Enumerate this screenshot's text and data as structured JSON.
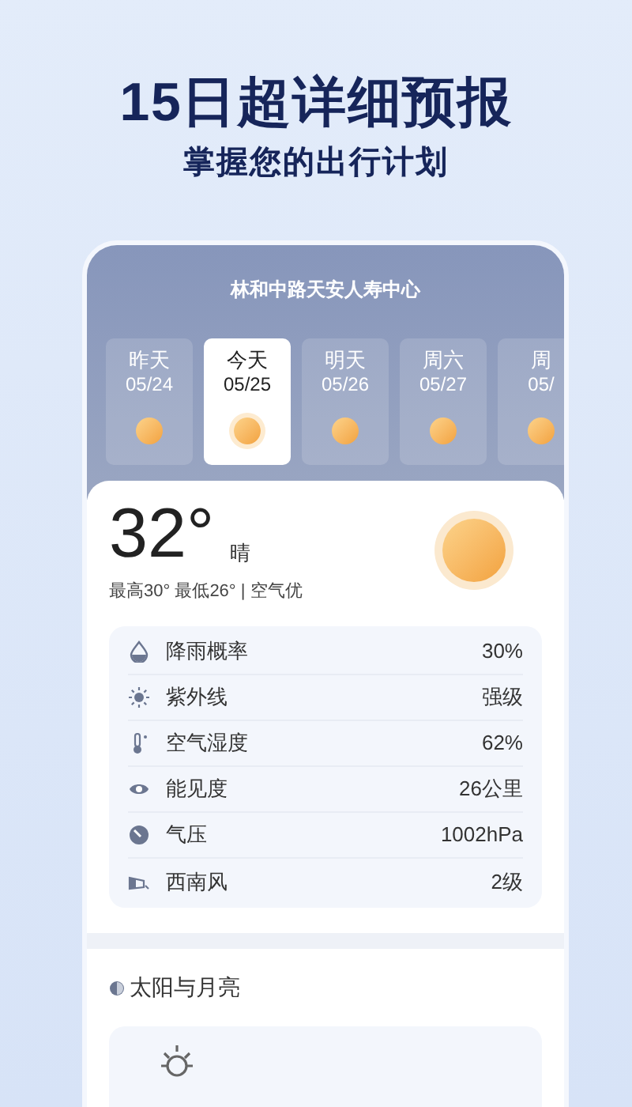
{
  "headline": "15日超详细预报",
  "subtitle": "掌握您的出行计划",
  "location": "林和中路天安人寿中心",
  "days": [
    {
      "label": "昨天",
      "date": "05/24",
      "selected": false
    },
    {
      "label": "今天",
      "date": "05/25",
      "selected": true
    },
    {
      "label": "明天",
      "date": "05/26",
      "selected": false
    },
    {
      "label": "周六",
      "date": "05/27",
      "selected": false
    },
    {
      "label": "周",
      "date": "05/",
      "selected": false
    }
  ],
  "current": {
    "temperature": "32°",
    "condition": "晴",
    "summary": "最高30° 最低26° | 空气优"
  },
  "details": [
    {
      "kind": "rain",
      "label": "降雨概率",
      "value": "30%"
    },
    {
      "kind": "uv",
      "label": "紫外线",
      "value": "强级"
    },
    {
      "kind": "humidity",
      "label": "空气湿度",
      "value": "62%"
    },
    {
      "kind": "visibility",
      "label": "能见度",
      "value": "26公里"
    },
    {
      "kind": "pressure",
      "label": "气压",
      "value": "1002hPa"
    },
    {
      "kind": "wind",
      "label": "西南风",
      "value": "2级"
    }
  ],
  "sun_moon": {
    "title": "太阳与月亮"
  }
}
